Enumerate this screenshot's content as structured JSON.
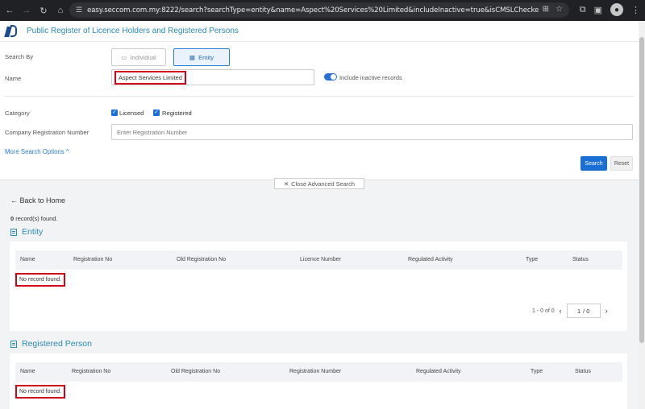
{
  "browser": {
    "url": "easy.seccom.com.my:8222/search?searchType=entity&name=Aspect%20Services%20Limited&includeInactive=true&isCMSLChecked=true&lice..."
  },
  "header": {
    "title": "Public Register of Licence Holders and Registered Persons"
  },
  "search_form": {
    "search_by_label": "Search By",
    "individual_label": "Individual",
    "entity_label": "Entity",
    "name_label": "Name",
    "name_value": "Aspect Services Limited",
    "include_inactive_label": "Include inactive records",
    "category_label": "Category",
    "licensed_label": "Licensed",
    "registered_label": "Registered",
    "company_reg_label": "Company Registration Number",
    "company_reg_placeholder": "Enter Registration Number",
    "more_options": "More Search Options ^",
    "search_button": "Search",
    "reset_button": "Reset",
    "close_advanced": "Close Advanced Search"
  },
  "results": {
    "back_label": "Back to Home",
    "record_count": "0",
    "record_count_suffix": "record(s) found.",
    "entity": {
      "title": "Entity",
      "columns": [
        "Name",
        "Registration No",
        "Old Registration No",
        "Licence Number",
        "Regulated Activity",
        "Type",
        "Status"
      ],
      "empty_message": "No record found.",
      "pagination_range": "1 - 0 of 0",
      "page_current": "1",
      "page_total": "/ 0"
    },
    "registered_person": {
      "title": "Registered Person",
      "columns": [
        "Name",
        "Registration No",
        "Old Registration No",
        "Registration Number",
        "Regulated Activity",
        "Type",
        "Status"
      ],
      "empty_message": "No record found."
    }
  }
}
